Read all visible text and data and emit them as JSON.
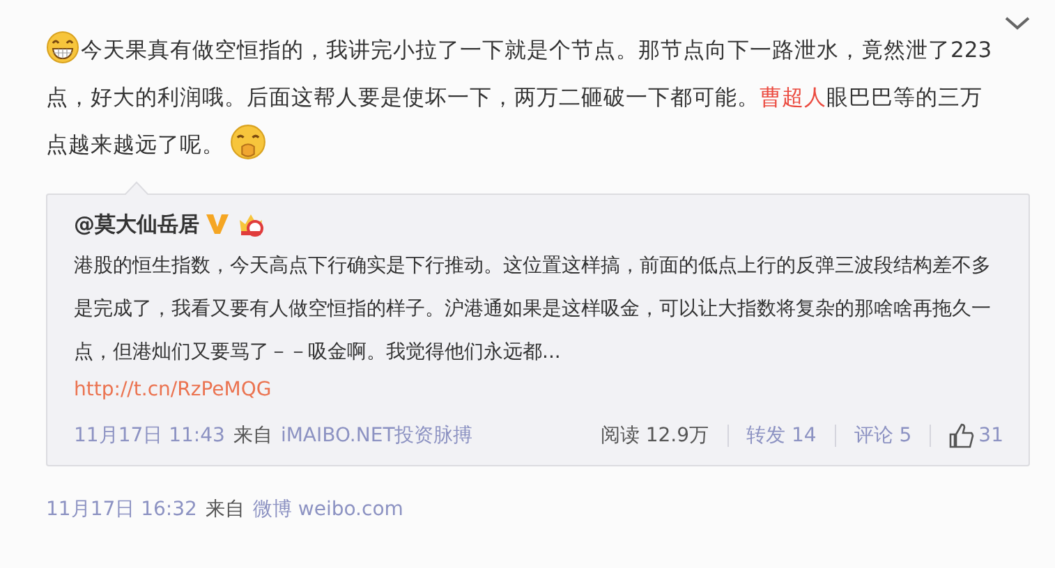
{
  "post": {
    "segments": [
      {
        "kind": "emoji"
      },
      {
        "kind": "text",
        "text": "今天果真有做空恒指的，我讲完小拉了一下就是个节点。那节点向下一路泄水，竟然泄了223点，好大的利润哦。后面这帮人要是使坏一下，两万二砸破一下都可能。"
      },
      {
        "kind": "mention",
        "text": "曹超人"
      },
      {
        "kind": "text",
        "text": "眼巴巴等的三万点越来越远了呢。"
      },
      {
        "kind": "emoji"
      }
    ],
    "quote": {
      "author": "@莫大仙岳居",
      "verified": true,
      "text": "港股的恒生指数，今天高点下行确实是下行推动。这位置这样搞，前面的低点上行的反弹三波段结构差不多是完成了，我看又要有人做空恒指的样子。沪港通如果是这样吸金，可以让大指数将复杂的那啥啥再拖久一点，但港灿们又要骂了－－吸金啊。我觉得他们永远都...",
      "link": "http://t.cn/RzPeMQG",
      "time": "11月17日 11:43",
      "from": "来自",
      "source": "iMAIBO.NET投资脉搏",
      "stats": [
        {
          "kind": "reads",
          "text": "阅读 12.9万"
        },
        {
          "kind": "reposts",
          "text": "转发 14"
        },
        {
          "kind": "comments",
          "text": "评论 5"
        },
        {
          "kind": "likes",
          "text": "31"
        }
      ]
    },
    "time": "11月17日 16:32",
    "from": "来自",
    "source": "微博 weibo.com"
  }
}
